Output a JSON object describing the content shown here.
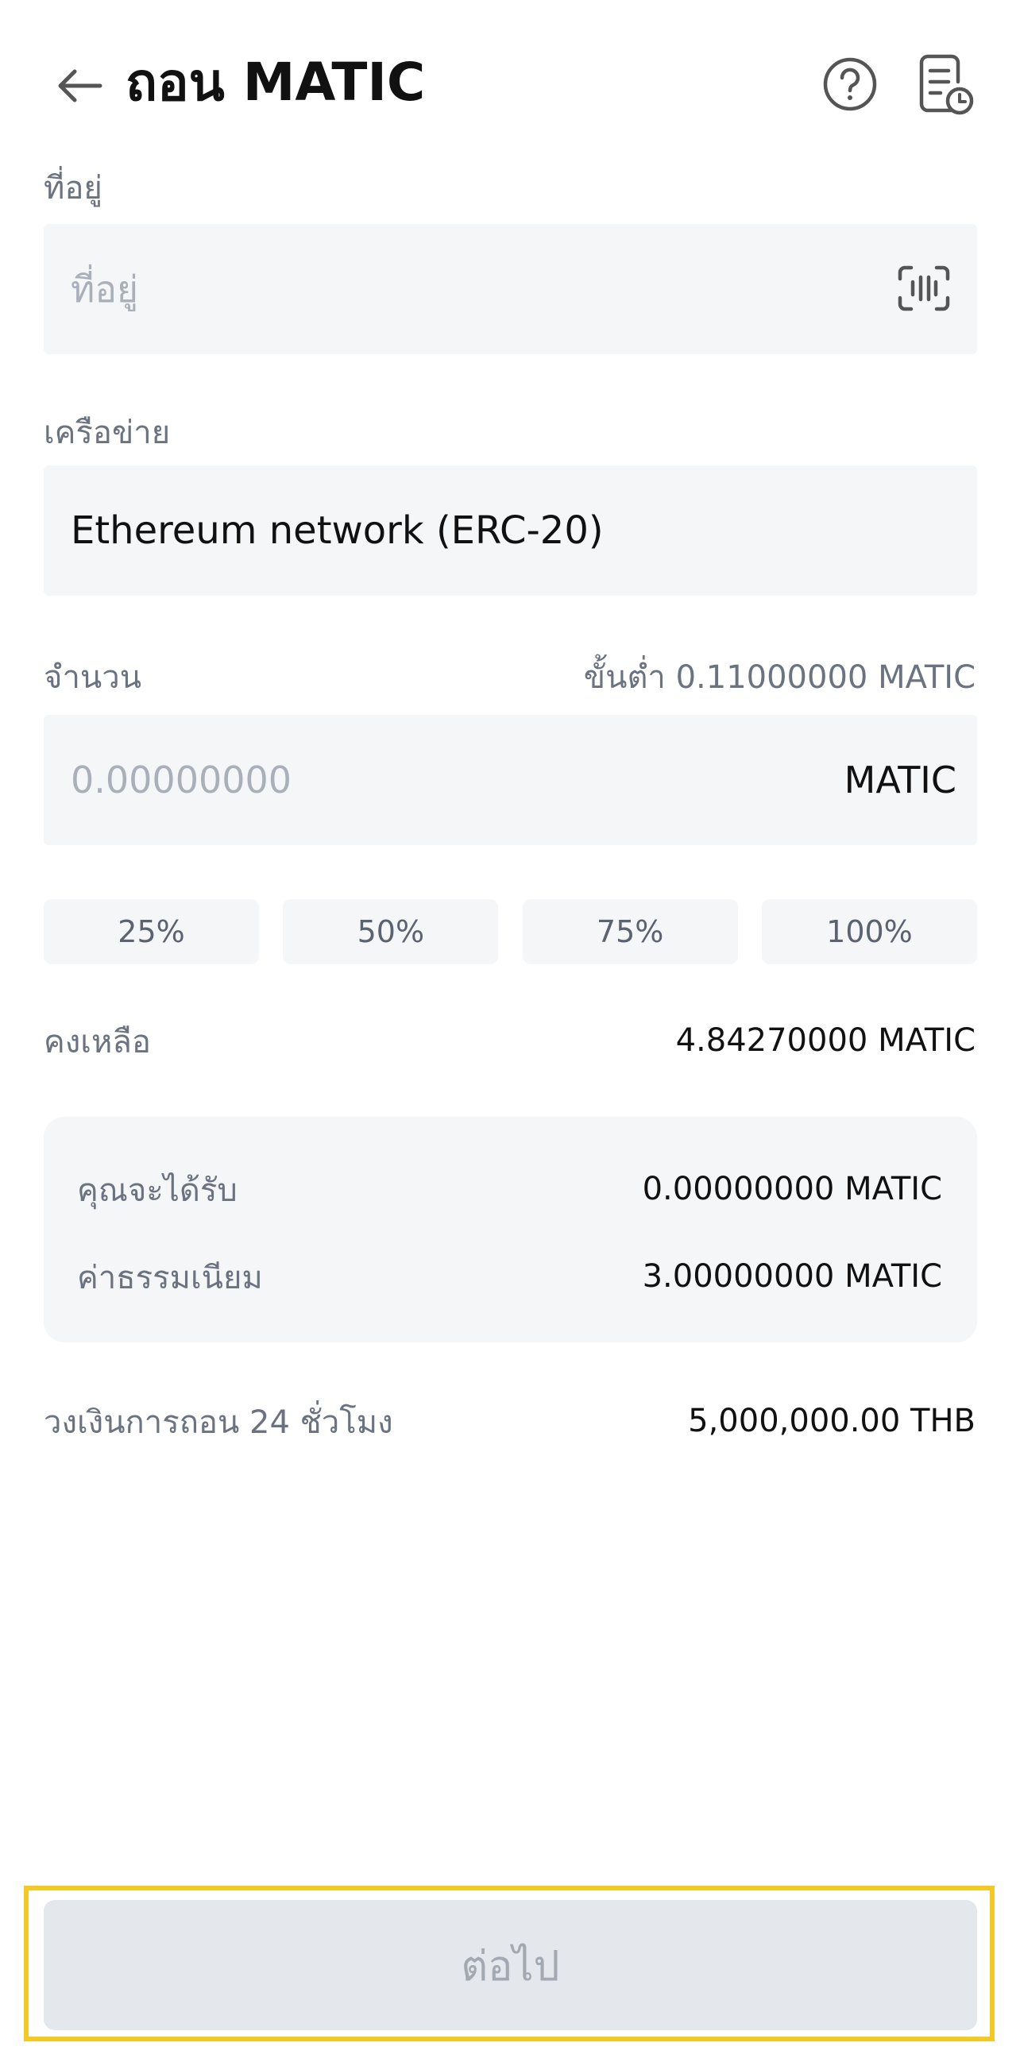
{
  "header": {
    "title": "ถอน MATIC"
  },
  "address": {
    "label": "ที่อยู่",
    "placeholder": "ที่อยู่"
  },
  "network": {
    "label": "เครือข่าย",
    "value": "Ethereum network (ERC-20)"
  },
  "amount": {
    "label": "จำนวน",
    "minimum": "ขั้นต่ำ 0.11000000 MATIC",
    "placeholder": "0.00000000",
    "unit": "MATIC"
  },
  "percent_buttons": [
    "25%",
    "50%",
    "75%",
    "100%"
  ],
  "balance": {
    "label": "คงเหลือ",
    "value": "4.84270000 MATIC"
  },
  "summary": {
    "receive_label": "คุณจะได้รับ",
    "receive_value": "0.00000000 MATIC",
    "fee_label": "ค่าธรรมเนียม",
    "fee_value": "3.00000000 MATIC"
  },
  "limit": {
    "label": "วงเงินการถอน 24 ชั่วโมง",
    "value": "5,000,000.00 THB"
  },
  "next_button": {
    "label": "ต่อไป"
  },
  "colors": {
    "field_bg": "#f5f6f8",
    "muted_text": "#6b7280",
    "placeholder_text": "#a9b0ba",
    "disabled_button_bg": "#e4e7eb",
    "highlight_border": "#f2c927"
  },
  "icons": {
    "back": "arrow-left-icon",
    "help": "question-circle-icon",
    "history": "document-clock-icon",
    "scan": "scan-icon"
  }
}
